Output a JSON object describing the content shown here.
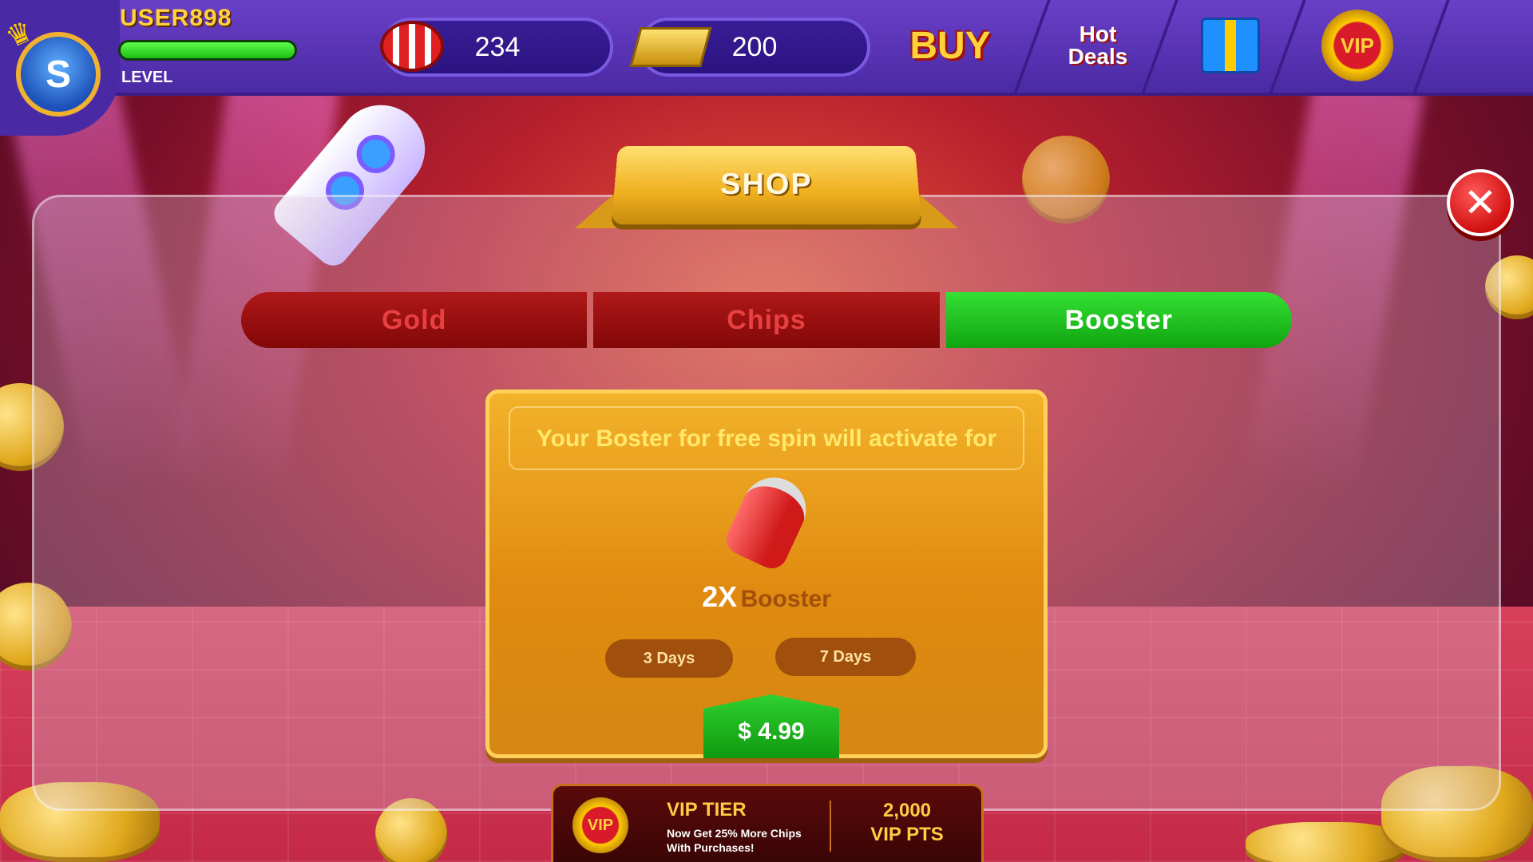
{
  "header": {
    "username": "USER898",
    "level_label": "LEVEL",
    "level_progress": 1.0,
    "chips_amount": "234",
    "gold_amount": "200",
    "buy_label": "BUY",
    "hot_deals_label": "Hot Deals",
    "vip_label": "VIP",
    "icons": {
      "avatar": "hedgehog-avatar",
      "crown": "crown-icon",
      "chips": "poker-chips-icon",
      "gold": "gold-bars-icon",
      "gift": "gift-icon",
      "menu": "hamburger-menu-icon"
    }
  },
  "shop": {
    "title": "SHOP",
    "close_label": "✕",
    "tabs": [
      {
        "label": "Gold",
        "active": false
      },
      {
        "label": "Chips",
        "active": false
      },
      {
        "label": "Booster",
        "active": true
      }
    ]
  },
  "offer": {
    "headline": "Your Boster for free spin will activate for",
    "multiplier": "2X",
    "booster_word": "Booster",
    "durations": [
      "3 Days",
      "7 Days"
    ],
    "price": "$ 4.99",
    "icon": "rocket-booster-icon"
  },
  "vip": {
    "badge": "VIP",
    "tier_label": "VIP TIER",
    "description": "Now Get 25% More Chips With Purchases!",
    "points_value": "2,000",
    "points_label": "VIP PTS"
  },
  "colors": {
    "topbar": "#5a34b8",
    "active_tab": "#22c022",
    "inactive_tab": "#9a1010",
    "offer_card": "#e8a020",
    "price_button": "#1fb81f",
    "close_button": "#e01818"
  }
}
